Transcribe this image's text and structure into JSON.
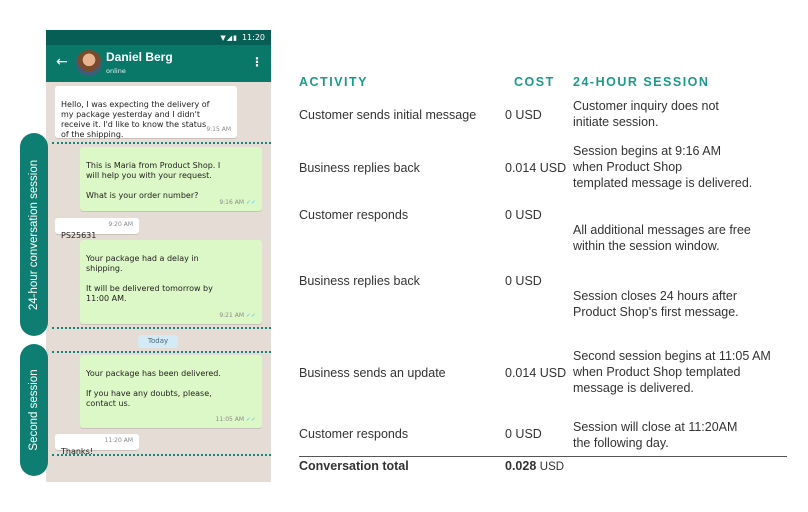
{
  "phone": {
    "status_time": "11:20",
    "contact_name": "Daniel Berg",
    "contact_status": "online",
    "messages": [
      {
        "text": "Hello, I was expecting the delivery of\nmy package yesterday and I didn't\nreceive it. I'd like to know the status\nof the shipping.",
        "time": "9:15 AM"
      },
      {
        "text": "This is Maria from Product Shop. I\nwill help you with your request.\n\nWhat is your order number?",
        "time": "9:16 AM"
      },
      {
        "text": "PS25631",
        "time": "9:20 AM"
      },
      {
        "text": "Your package had a delay in\nshipping.\n\nIt will be delivered tomorrow by\n11:00 AM.",
        "time": "9:21 AM"
      },
      {
        "text": "Your package has been delivered.\n\nIf you have any doubts, please,\ncontact us.",
        "time": "11:05 AM"
      },
      {
        "text": "Thanks!",
        "time": "11:20 AM"
      }
    ],
    "day_divider": "Today",
    "session_labels": [
      "24-hour conversation session",
      "Second session"
    ]
  },
  "table": {
    "headers": {
      "activity": "ACTIVITY",
      "cost": "COST",
      "session": "24-HOUR SESSION"
    },
    "rows": [
      {
        "activity": "Customer sends initial message",
        "cost": "0 USD",
        "session": "Customer inquiry does not\ninitiate session."
      },
      {
        "activity": "Business replies back",
        "cost": "0.014 USD",
        "session": "Session begins at 9:16 AM\nwhen Product Shop\ntemplated message is delivered."
      },
      {
        "activity": "Customer responds",
        "cost": "0 USD",
        "session": "All additional messages are free\nwithin the session window."
      },
      {
        "activity": "Business replies back",
        "cost": "0 USD",
        "session": "Session closes 24 hours after\nProduct Shop's first message."
      },
      {
        "activity": "Business sends an update",
        "cost": "0.014 USD",
        "session": "Second session begins at 11:05 AM\nwhen Product Shop templated\nmessage is delivered."
      },
      {
        "activity": "Customer responds",
        "cost": "0 USD",
        "session": "Session will close at 11:20AM\nthe following day."
      }
    ],
    "total": {
      "label": "Conversation total",
      "cost": "0.028",
      "unit": "USD"
    }
  },
  "colors": {
    "header_teal": "#1a9b89",
    "appbar": "#0a7869",
    "outgoing_bubble": "#dcf8c6",
    "session_pill": "#0f7e72"
  }
}
